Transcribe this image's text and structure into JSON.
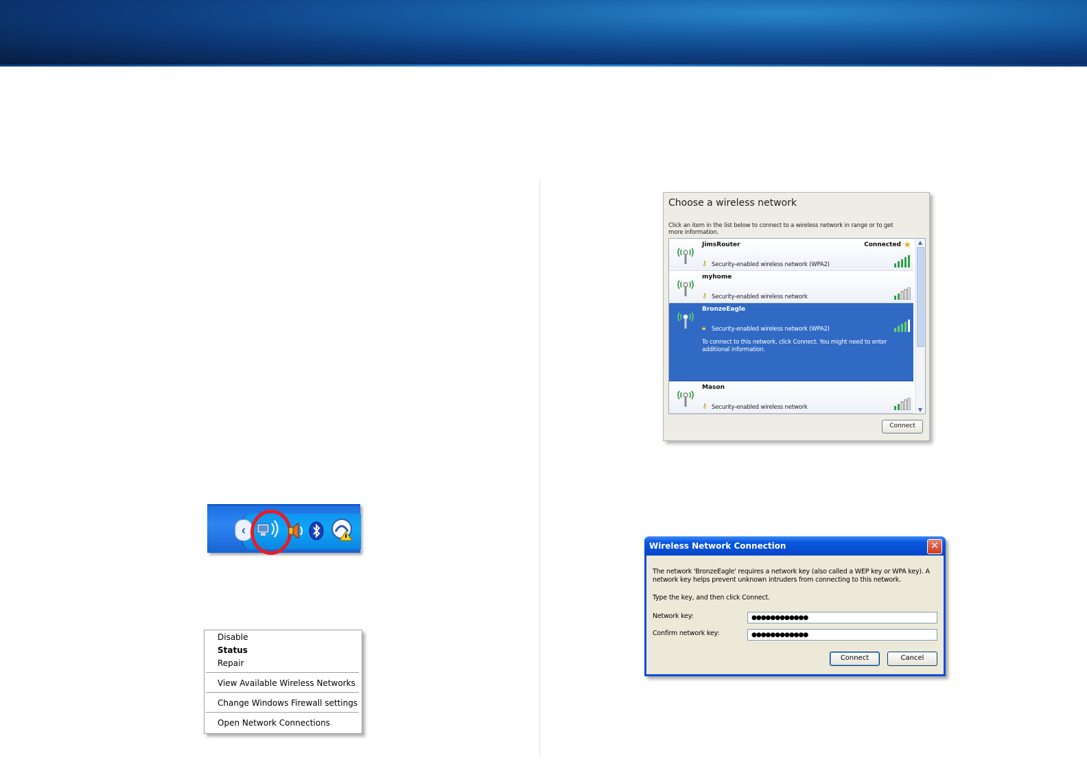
{
  "tray": {
    "arrow": "‹"
  },
  "context_menu": {
    "items": [
      "Disable",
      "Status",
      "Repair",
      "View Available Wireless Networks",
      "Change Windows Firewall settings",
      "Open Network Connections"
    ]
  },
  "choose_network": {
    "title": "Choose a wireless network",
    "description": "Click an item in the list below to connect to a wireless network in range or to get more information.",
    "networks": [
      {
        "name": "JimsRouter",
        "security": "Security-enabled wireless network (WPA2)",
        "status": "Connected",
        "selected": false
      },
      {
        "name": "myhome",
        "security": "Security-enabled wireless network",
        "status": "",
        "selected": false
      },
      {
        "name": "BronzeEagle",
        "security": "Security-enabled wireless network (WPA2)",
        "status": "",
        "selected": true,
        "hint": "To connect to this network, click Connect. You might need to enter additional information."
      },
      {
        "name": "Mason",
        "security": "Security-enabled wireless network",
        "status": "",
        "selected": false
      }
    ],
    "connect_label": "Connect"
  },
  "wnc_dialog": {
    "title": "Wireless Network Connection",
    "close_label": "✕",
    "message": "The network 'BronzeEagle' requires a network key (also called a WEP key or WPA key). A network key helps prevent unknown intruders from connecting to this network.",
    "instruction": "Type the key, and then click Connect.",
    "network_key_label": "Network key:",
    "network_key_value": "●●●●●●●●●●●●",
    "confirm_key_label": "Confirm network key:",
    "confirm_key_value": "●●●●●●●●●●●●",
    "connect_label": "Connect",
    "cancel_label": "Cancel"
  }
}
